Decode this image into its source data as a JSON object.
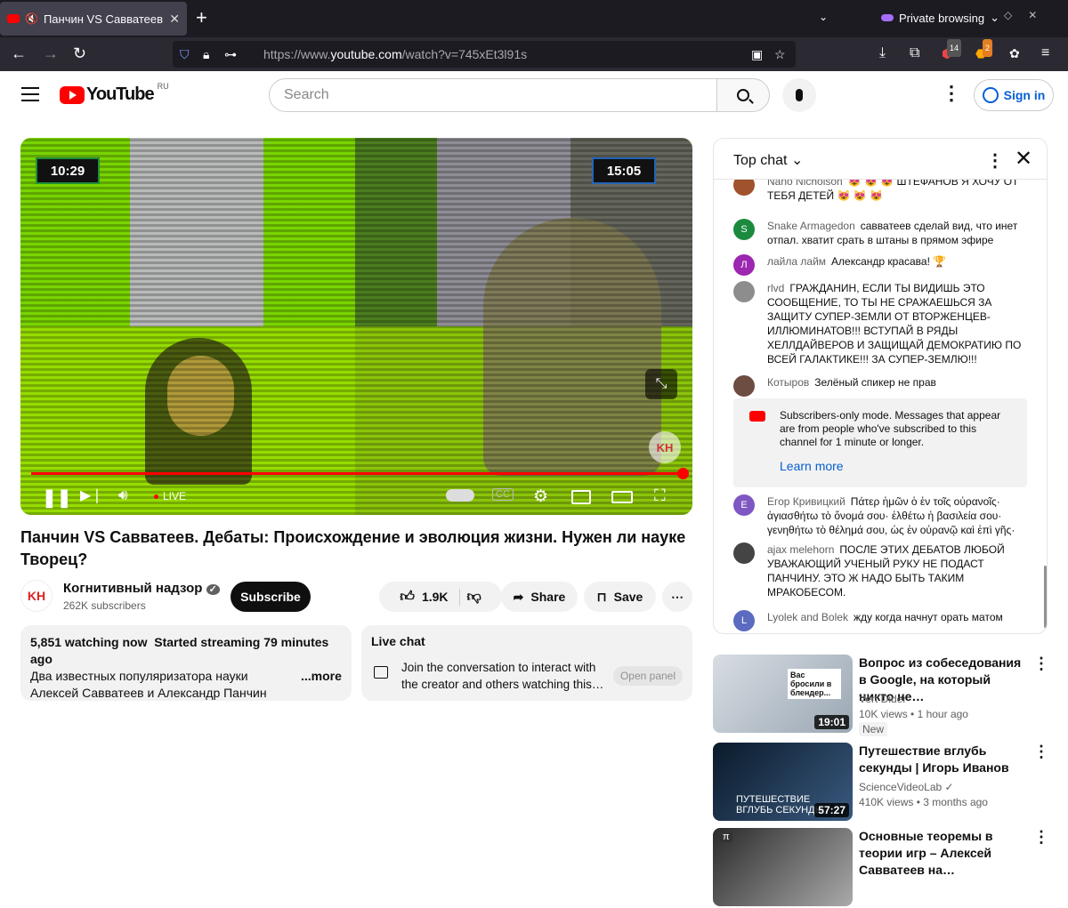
{
  "browser": {
    "tab_title": "Панчин VS Савватеев.",
    "new_tab": "+",
    "private_label": "Private browsing",
    "url_prefix": "https://www.",
    "url_host": "youtube.com",
    "url_path": "/watch?v=745xEt3l91s",
    "ext_badge_1": "14",
    "ext_badge_2": "2"
  },
  "header": {
    "logo_text": "YouTube",
    "country_code": "RU",
    "search_placeholder": "Search",
    "signin_label": "Sign in"
  },
  "player": {
    "clock_left": "10:29",
    "clock_right": "15:05",
    "live_label": "LIVE",
    "channel_watermark": "KH",
    "progress": 1.0
  },
  "video": {
    "title": "Панчин VS Савватеев. Дебаты: Происхождение и эволюция жизни. Нужен ли науке Творец?",
    "channel_logo_text": "KH",
    "channel_name": "Когнитивный надзор",
    "verified_mark": "✓",
    "subscribers": "262K subscribers",
    "subscribe_label": "Subscribe",
    "likes": "1.9K",
    "share_label": "Share",
    "save_label": "Save",
    "more_label": "⋯"
  },
  "description": {
    "watching": "5,851 watching now",
    "started": "Started streaming 79 minutes ago",
    "text": "Два известных популяризатора науки Алексей Савватеев и Александр Панчин сегодня вышли",
    "more": "...more"
  },
  "livebox": {
    "header": "Live chat",
    "text": "Join the conversation to interact with the creator and others watching this…",
    "open_panel": "Open panel"
  },
  "chat": {
    "header": "Top chat",
    "messages": [
      {
        "author": "Nano Nicholson",
        "text": "😻 😻 😻 ШТЕФАНОВ Я ХОЧУ ОТ ТЕБЯ ДЕТЕЙ 😻 😻 😻",
        "avatar": "",
        "color": "#a0522d"
      },
      {
        "author": "Snake Armagedon",
        "text": "савватеев сделай вид, что инет отпал. хватит срать в штаны в прямом эфире",
        "avatar": "S",
        "color": "#1b8a3e"
      },
      {
        "author": "лайла лайм",
        "text": "Александр красава! 🏆",
        "avatar": "Л",
        "color": "#9c27b0"
      },
      {
        "author": "rlvd",
        "text": "ГРАЖДАНИН, ЕСЛИ ТЫ ВИДИШЬ ЭТО СООБЩЕНИЕ, ТО ТЫ НЕ СРАЖАЕШЬСЯ ЗА ЗАЩИТУ СУПЕР-ЗЕМЛИ ОТ ВТОРЖЕНЦЕВ-ИЛЛЮМИНАТОВ!!! ВСТУПАЙ В РЯДЫ ХЕЛЛДАЙВЕРОВ И ЗАЩИЩАЙ ДЕМОКРАТИЮ ПО ВСЕЙ ГАЛАКТИКЕ!!! ЗА СУПЕР-ЗЕМЛЮ!!!",
        "avatar": "",
        "color": "#8d8d8d"
      },
      {
        "author": "Котыров",
        "text": "Зелёный спикер не прав",
        "avatar": "",
        "color": "#6d4c41"
      },
      {
        "author": "Егор Кривицкий",
        "text": "Πάτερ ἡμῶν ὁ ἐν τοῖς οὐρανοῖς· ἁγιασθήτω τὸ ὄνομά σου· ἐλθέτω ἡ βασιλεία σου· γενηθήτω τὸ θέλημά σου, ὡς ἐν οὐρανῷ καὶ ἐπὶ γῆς·",
        "avatar": "E",
        "color": "#7e57c2"
      },
      {
        "author": "ajax melehorn",
        "text": "ПОСЛЕ ЭТИХ ДЕБАТОВ ЛЮБОЙ УВАЖАЮЩИЙ УЧЕНЫЙ РУКУ НЕ ПОДАСТ ПАНЧИНУ. ЭТО Ж НАДО БЫТЬ ТАКИМ МРАКОБЕСОМ.",
        "avatar": "",
        "color": "#444444"
      },
      {
        "author": "Lyolek and Bolek",
        "text": "жду когда начнут орать матом",
        "avatar": "L",
        "color": "#5c6bc0"
      }
    ],
    "notice_text": "Subscribers-only mode. Messages that appear are from people who've subscribed to this channel for 1 minute or longer.",
    "notice_link": "Learn more"
  },
  "recommendations": [
    {
      "title": "Вопрос из собеседования в Google, на который никто не…",
      "channel": "Vert Dider",
      "views": "10K views",
      "age": "1 hour ago",
      "badge": "New",
      "duration": "19:01",
      "thumb_caption": "Вас бросили в блендер..."
    },
    {
      "title": "Путешествие вглубь секунды | Игорь Иванов",
      "channel": "ScienceVideoLab",
      "views": "410K views",
      "age": "3 months ago",
      "badge": "",
      "duration": "57:27",
      "thumb_caption": "ПУТЕШЕСТВИЕ ВГЛУБЬ СЕКУНДЫ"
    },
    {
      "title": "Основные теоремы в теории игр – Алексей Савватеев на…",
      "channel": "",
      "views": "",
      "age": "",
      "badge": "",
      "duration": "",
      "thumb_caption": "π"
    }
  ],
  "colors": {
    "accent": "#ff0000",
    "link": "#065fd4",
    "chroma": "#7ed000"
  }
}
